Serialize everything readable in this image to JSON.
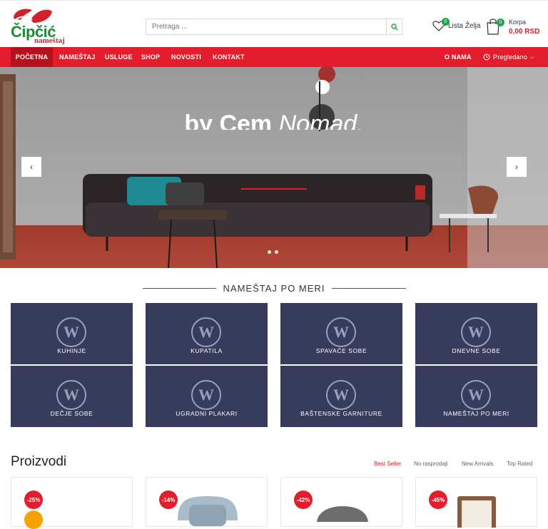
{
  "brand": {
    "name": "Čipčić",
    "tagline": "nameštaj"
  },
  "search": {
    "placeholder": "Pretraga ..."
  },
  "wishlist": {
    "label": "Lista Želja",
    "count": "0"
  },
  "cart": {
    "label": "Korpa",
    "total": "0,00 RSD",
    "count": "0"
  },
  "nav": {
    "items": [
      "POČETNA",
      "NAMEŠTAJ",
      "USLUGE",
      "SHOP",
      "NOVOSTI",
      "KONTAKT"
    ],
    "right": {
      "about": "O NAMA",
      "recent": "Pregledano"
    }
  },
  "hero": {
    "caption_plain": "by Cem",
    "caption_italic": "Nomad."
  },
  "categories_section": {
    "title": "NAMEŠTAJ PO MERI",
    "tiles": [
      "KUHINJE",
      "KUPATILA",
      "SPAVAĆE SOBE",
      "DNEVNE SOBE",
      "DEČJE SOBE",
      "UGRADNI PLAKARI",
      "BAŠTENSKE GARNITURE",
      "NAMEŠTAJ PO MERI"
    ],
    "tile_icon": "wordpress-icon"
  },
  "products": {
    "title": "Proizvodi",
    "tabs": [
      "Best Seller",
      "No rasprodaji",
      "New Arrivals",
      "Top Rated"
    ],
    "discounts": [
      "-25%",
      "-14%",
      "-42%",
      "-45%"
    ]
  },
  "colors": {
    "accent": "#e31d2b",
    "tile_bg": "#373b5c",
    "badge": "#1fa34a"
  }
}
